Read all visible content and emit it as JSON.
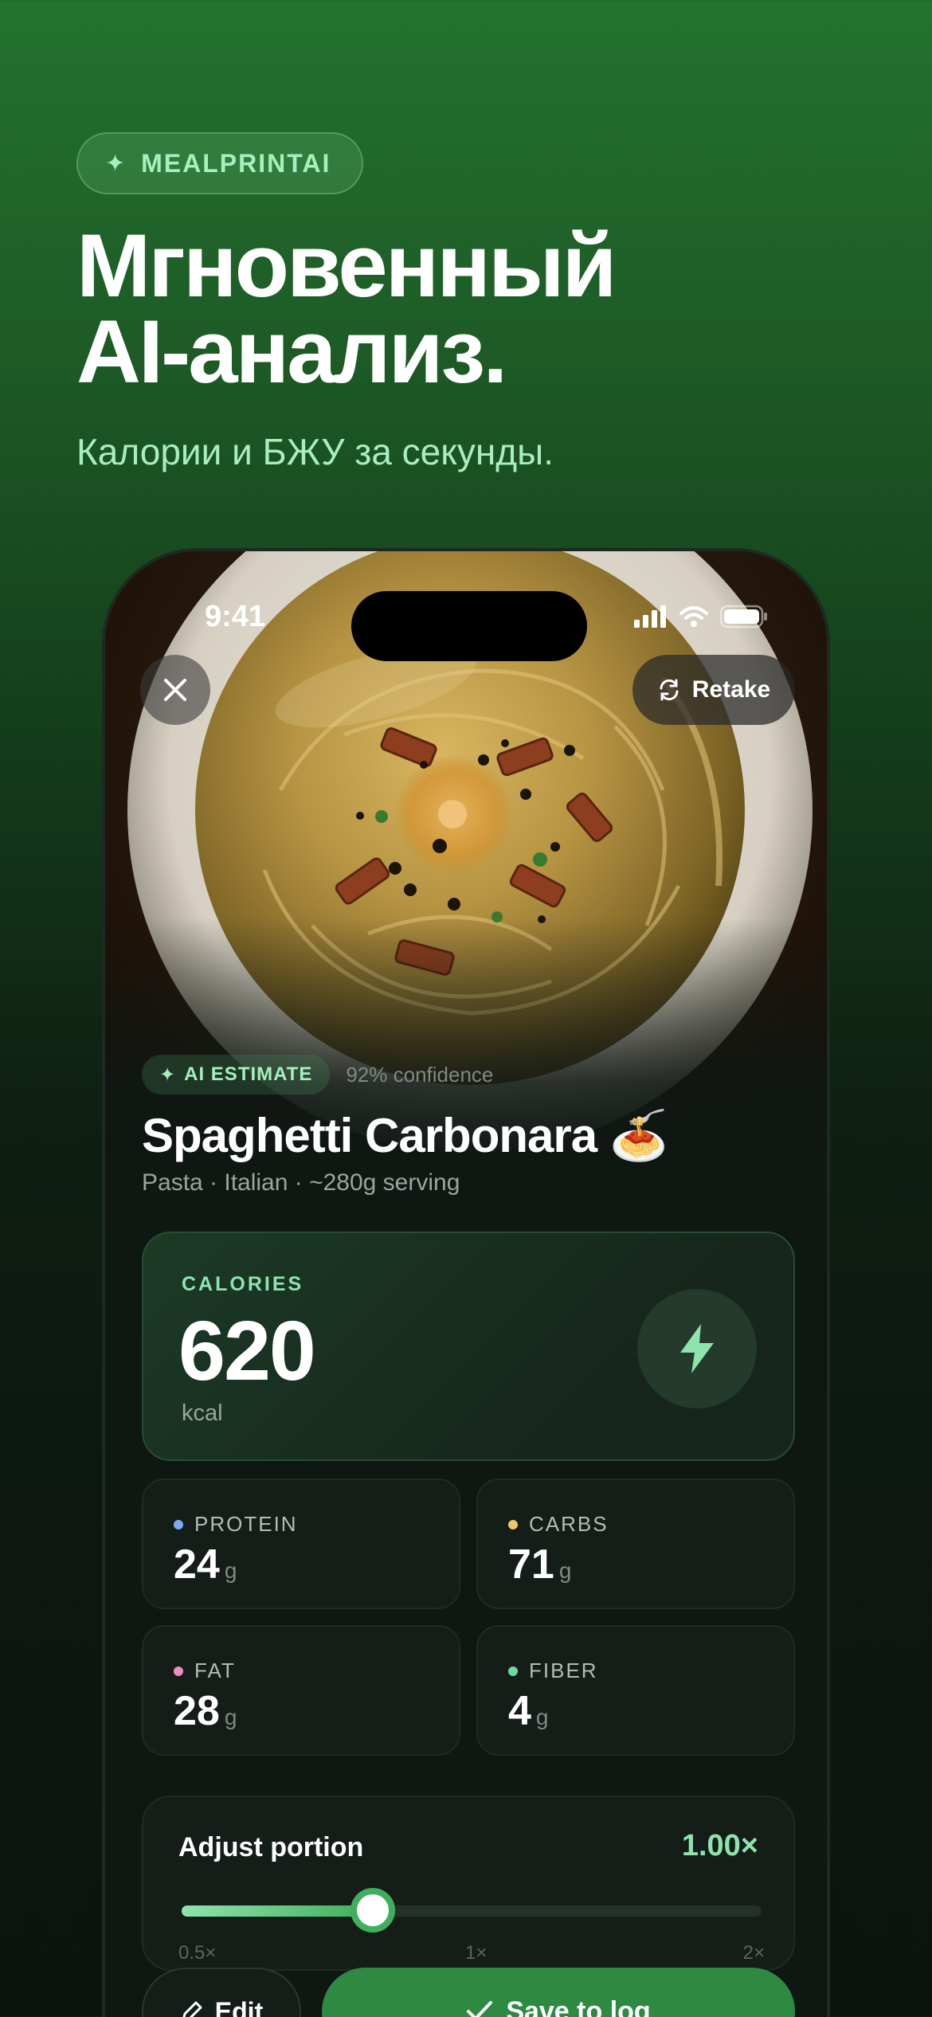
{
  "hero": {
    "brand": "MEALPRINTAI",
    "title_line1": "Мгновенный",
    "title_line2": "AI-анализ.",
    "subtitle": "Калории и БЖУ за секунды."
  },
  "status_bar": {
    "time": "9:41"
  },
  "photo_controls": {
    "retake_label": "Retake"
  },
  "analysis": {
    "badge": "AI ESTIMATE",
    "confidence": "92% confidence",
    "dish_name": "Spaghetti Carbonara 🍝",
    "dish_meta": "Pasta · Italian · ~280g serving"
  },
  "calories": {
    "label": "CALORIES",
    "value": "620",
    "unit": "kcal"
  },
  "macros": [
    {
      "label": "PROTEIN",
      "value": "24",
      "unit": "g",
      "color": "#7fa8f5"
    },
    {
      "label": "CARBS",
      "value": "71",
      "unit": "g",
      "color": "#f2c46d"
    },
    {
      "label": "FAT",
      "value": "28",
      "unit": "g",
      "color": "#f08ac0"
    },
    {
      "label": "FIBER",
      "value": "4",
      "unit": "g",
      "color": "#6ed9a0"
    }
  ],
  "portion": {
    "title": "Adjust portion",
    "value": "1.00×",
    "slider_fraction": 0.33,
    "tick_min": "0.5×",
    "tick_mid": "1×",
    "tick_max": "2×"
  },
  "actions": {
    "edit_label": "Edit",
    "save_label": "Save to log"
  },
  "colors": {
    "accent": "#8fe3ac",
    "primary_button": "#2e8a43"
  }
}
